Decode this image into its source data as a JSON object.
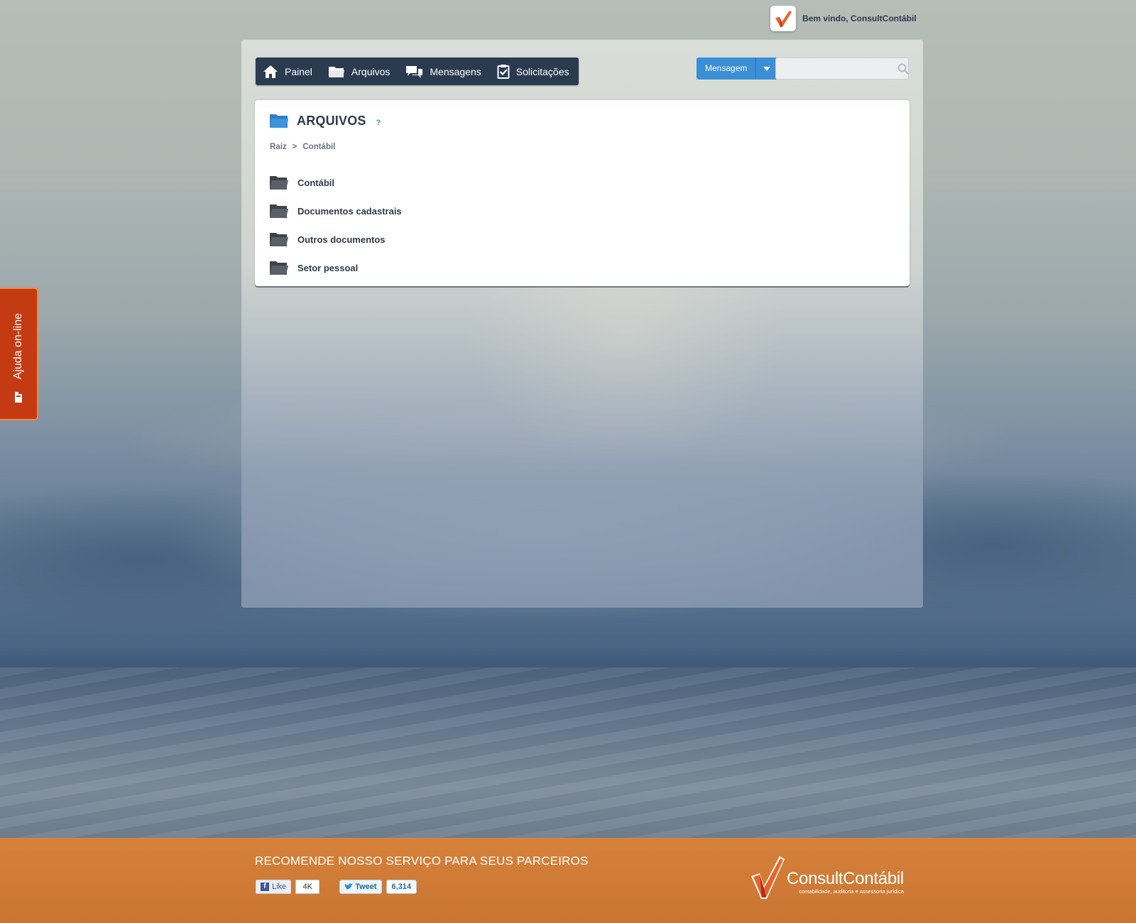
{
  "header": {
    "welcome_text": "Bem vindo, ConsultContábil"
  },
  "nav": {
    "items": [
      {
        "label": "Painel",
        "icon": "home-icon"
      },
      {
        "label": "Arquivos",
        "icon": "folder-icon"
      },
      {
        "label": "Mensagens",
        "icon": "chat-bubbles-icon"
      },
      {
        "label": "Solicitações",
        "icon": "clipboard-check-icon"
      }
    ]
  },
  "toolbar": {
    "message_button_label": "Mensagem",
    "search_placeholder": ""
  },
  "files": {
    "title": "ARQUIVOS",
    "help_label": "?",
    "breadcrumb": [
      "Raiz",
      ">",
      "Contábil"
    ],
    "folders": [
      "Contábil",
      "Documentos cadastrais",
      "Outros documentos",
      "Setor pessoal"
    ]
  },
  "side_tab": {
    "label": "Ajuda on-line"
  },
  "footer": {
    "title": "RECOMENDE NOSSO SERVIÇO PARA SEUS PARCEIROS",
    "fb_like_label": "Like",
    "fb_like_count": "4K",
    "tweet_label": "Tweet",
    "tweet_count": "6,314",
    "brand_name": "ConsultContábil",
    "brand_tagline": "contabilidade, auditoria e assessoria jurídica"
  },
  "colors": {
    "nav_bg": "#2a3b50",
    "accent_blue": "#3a8fd6",
    "help_tab": "#c43a12",
    "footer": "#d6813a"
  }
}
